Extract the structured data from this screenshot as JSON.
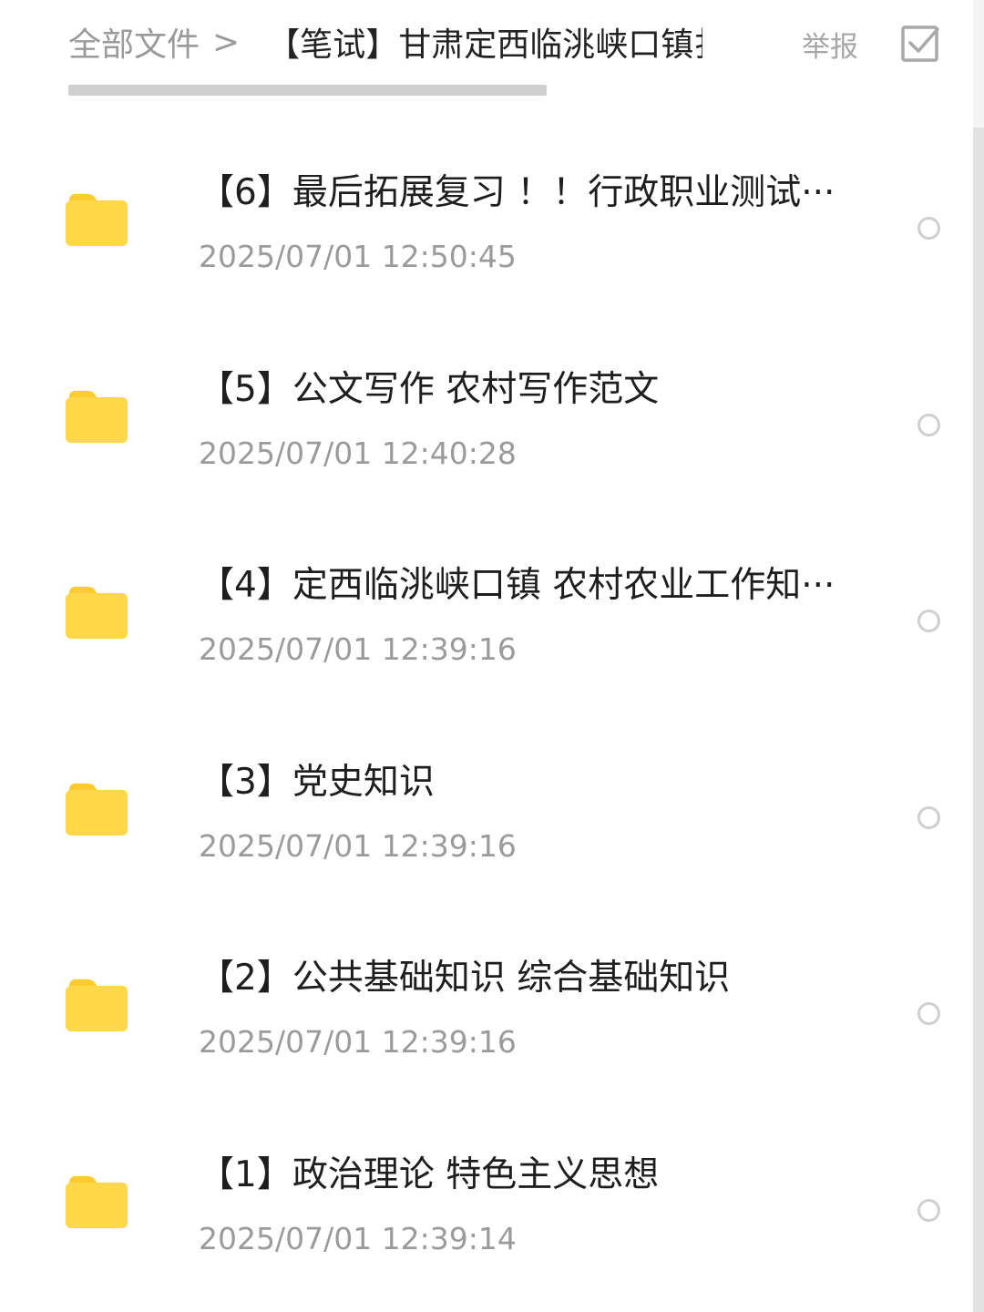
{
  "header": {
    "breadcrumb_root": "全部文件",
    "breadcrumb_separator": ">",
    "current_folder": "【笔试】甘肃定西临洮峡口镇扌",
    "report_label": "举报",
    "select_icon": "checkbox-select-all-icon"
  },
  "files": [
    {
      "name": "【6】最后拓展复习 ！！行政职业测试···",
      "date": "2025/07/01  12:50:45"
    },
    {
      "name": "【5】公文写作  农村写作范文",
      "date": "2025/07/01  12:40:28"
    },
    {
      "name": "【4】定西临洮峡口镇  农村农业工作知···",
      "date": "2025/07/01  12:39:16"
    },
    {
      "name": "【3】党史知识",
      "date": "2025/07/01  12:39:16"
    },
    {
      "name": "【2】公共基础知识  综合基础知识",
      "date": "2025/07/01  12:39:16"
    },
    {
      "name": "【1】政治理论  特色主义思想",
      "date": "2025/07/01  12:39:14"
    }
  ],
  "colors": {
    "folder": "#FFD84A",
    "folder_tab": "#FCCB2F",
    "text_primary": "#1E1E1E",
    "text_secondary": "#9B9B9B"
  }
}
